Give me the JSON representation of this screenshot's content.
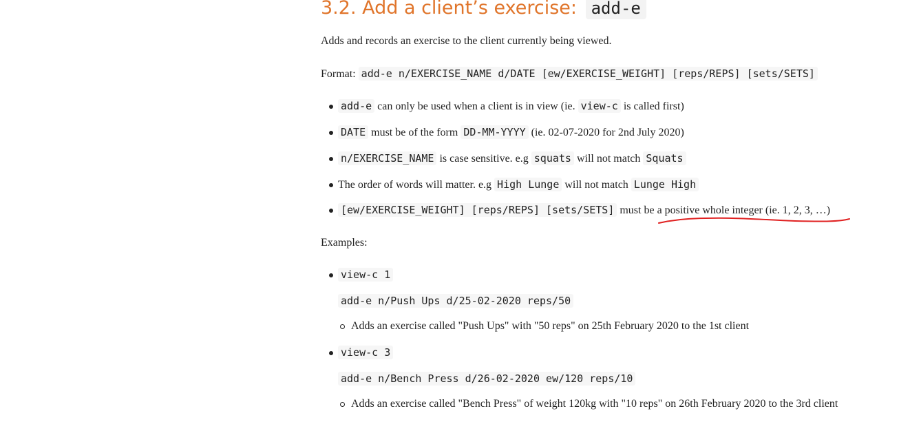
{
  "heading": {
    "text": "3.2. Add a client’s exercise:",
    "code": "add-e"
  },
  "description": "Adds and records an exercise to the client currently being viewed.",
  "format": {
    "label": "Format:",
    "code": "add-e n/EXERCISE_NAME d/DATE [ew/EXERCISE_WEIGHT] [reps/REPS] [sets/SETS]"
  },
  "rules": [
    {
      "code1": "add-e",
      "text1": "can only be used when a client is in view (ie.",
      "code2": "view-c",
      "text2": "is called first)"
    },
    {
      "code1": "DATE",
      "text1": "must be of the form",
      "code2": "DD-MM-YYYY",
      "text2": "(ie. 02-07-2020 for 2nd July 2020)"
    },
    {
      "code1": "n/EXERCISE_NAME",
      "text1": "is case sensitive. e.g",
      "code2": "squats",
      "text2": "will not match",
      "code3": "Squats"
    },
    {
      "text1": "The order of words will matter. e.g",
      "code1": "High Lunge",
      "text2": "will not match",
      "code2": "Lunge High"
    },
    {
      "code1": "[ew/EXERCISE_WEIGHT] [reps/REPS] [sets/SETS]",
      "text1": "must be a positive whole integer (ie. 1, 2, 3, …)"
    }
  ],
  "examples_label": "Examples:",
  "examples": [
    {
      "cmd1": "view-c 1",
      "cmd2": "add-e n/Push Ups d/25-02-2020 reps/50",
      "desc": "Adds an exercise called \"Push Ups\" with \"50 reps\" on 25th February 2020 to the 1st client"
    },
    {
      "cmd1": "view-c 3",
      "cmd2": "add-e n/Bench Press d/26-02-2020 ew/120 reps/10",
      "desc": "Adds an exercise called \"Bench Press\" of weight 120kg with \"10 reps\" on 26th February 2020 to the 3rd client"
    }
  ],
  "colors": {
    "heading": "#e0752b",
    "annotation": "#e02020",
    "code_bg": "#f6f6f6"
  }
}
